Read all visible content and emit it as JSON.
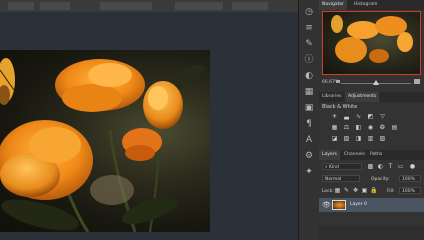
{
  "panels": {
    "navigator_tab": "Navigator",
    "histogram_tab": "Histogram",
    "libraries_tab": "Libraries",
    "adjustments_tab": "Adjustments",
    "layers_tab": "Layers",
    "channels_tab": "Channels",
    "paths_tab": "Paths"
  },
  "navigator": {
    "zoom": "66.67%"
  },
  "adjustments": {
    "title": "Black & White"
  },
  "layers": {
    "kind_label": "Kind",
    "blend_mode": "Normal",
    "opacity_label": "Opacity:",
    "opacity_value": "100%",
    "lock_label": "Lock:",
    "fill_label": "Fill:",
    "fill_value": "100%",
    "items": [
      {
        "name": "Layer 0"
      }
    ]
  },
  "colors": {
    "accent": "#d23b25",
    "selected_layer": "#4b5562"
  }
}
